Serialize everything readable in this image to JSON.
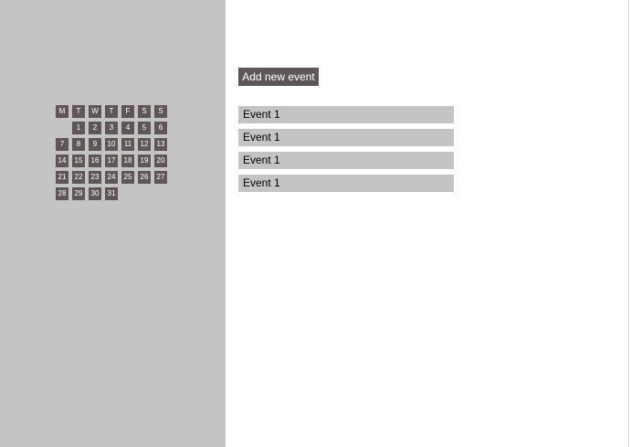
{
  "calendar": {
    "weekdays": [
      "M",
      "T",
      "W",
      "T",
      "F",
      "S",
      "S"
    ],
    "leading_empty_days": 1,
    "days": [
      "1",
      "2",
      "3",
      "4",
      "5",
      "6",
      "7",
      "8",
      "9",
      "10",
      "11",
      "12",
      "13",
      "14",
      "15",
      "16",
      "17",
      "18",
      "19",
      "20",
      "21",
      "22",
      "23",
      "24",
      "25",
      "26",
      "27",
      "28",
      "29",
      "30",
      "31"
    ]
  },
  "toolbar": {
    "add_label": "Add new event"
  },
  "events": [
    {
      "label": "Event 1"
    },
    {
      "label": "Event 1"
    },
    {
      "label": "Event 1"
    },
    {
      "label": "Event 1"
    }
  ],
  "colors": {
    "sidebar_bg": "#c4c4c4",
    "cell_bg": "#5f5757",
    "button_bg": "#5f5757",
    "event_bg": "#c4c4c4"
  }
}
